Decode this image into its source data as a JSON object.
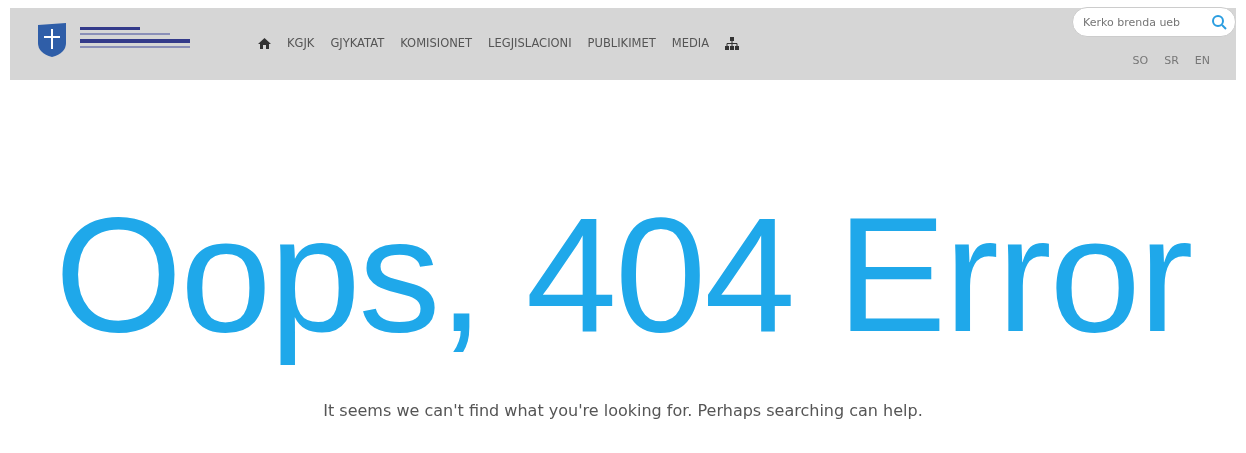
{
  "header": {
    "nav": [
      {
        "kind": "home"
      },
      {
        "kind": "text",
        "label": "KGJK"
      },
      {
        "kind": "text",
        "label": "GJYKATAT"
      },
      {
        "kind": "text",
        "label": "KOMISIONET"
      },
      {
        "kind": "text",
        "label": "LEGJISLACIONI"
      },
      {
        "kind": "text",
        "label": "PUBLIKIMET"
      },
      {
        "kind": "text",
        "label": "MEDIA"
      },
      {
        "kind": "sitemap"
      }
    ],
    "search": {
      "placeholder": "Kerko brenda ueb"
    },
    "languages": [
      "SO",
      "SR",
      "EN"
    ]
  },
  "error": {
    "heading": "Oops, 404 Error",
    "message": "It seems we can't find what you're looking for. Perhaps searching can help."
  }
}
